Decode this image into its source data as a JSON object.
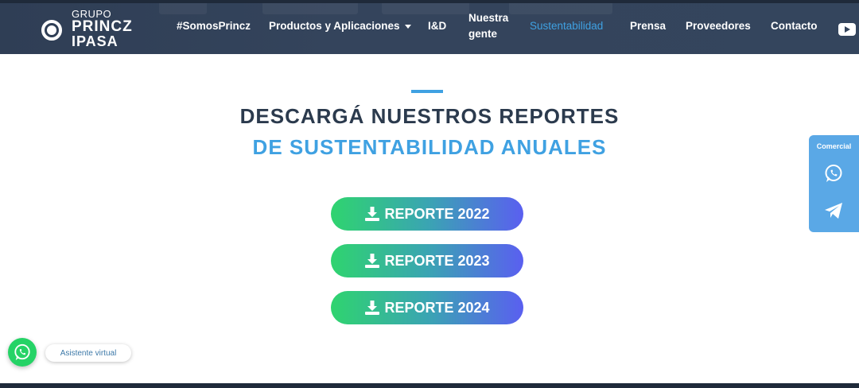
{
  "header": {
    "logo": {
      "line1": "GRUPO",
      "line2": "PRINCZ",
      "line3": "IPASA"
    },
    "nav": {
      "somos": "#SomosPrincz",
      "productos": "Productos y Aplicaciones",
      "id": "I&D",
      "nuestra_line1": "Nuestra",
      "nuestra_line2": "gente",
      "sustentabilidad": "Sustentabilidad",
      "prensa": "Prensa",
      "proveedores": "Proveedores",
      "contacto": "Contacto"
    },
    "active_item": "Sustentabilidad",
    "youtube_icon": "youtube-icon"
  },
  "main": {
    "title_line1": "DESCARGÁ NUESTROS REPORTES",
    "title_line2": "DE SUSTENTABILIDAD ANUALES",
    "reports": [
      "REPORTE 2022",
      "REPORTE 2023",
      "REPORTE 2024"
    ]
  },
  "side_panel": {
    "label": "Comercial",
    "icons": [
      "whatsapp-icon",
      "telegram-icon"
    ]
  },
  "assistant": {
    "label": "Asistente virtual",
    "icon": "whatsapp-icon"
  },
  "colors": {
    "header_bg": "#34445c",
    "accent_blue": "#3fa1e2",
    "title_dark": "#2b3a4d",
    "button_gradient_start": "#2fd46f",
    "button_gradient_end": "#5a5ff0",
    "whatsapp_green": "#25d366",
    "side_panel": "#5aa8e6"
  }
}
